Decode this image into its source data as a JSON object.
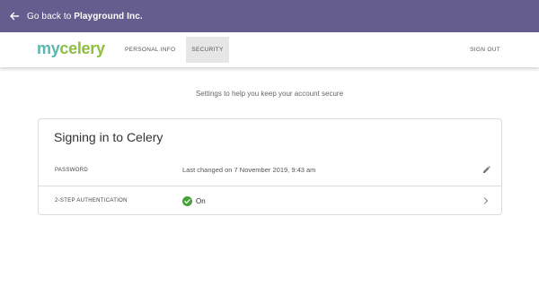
{
  "topbar": {
    "back_prefix": "Go back to ",
    "back_org": "Playground Inc."
  },
  "nav": {
    "logo_part1": "my",
    "logo_part2": "celery",
    "tabs": [
      {
        "label": "PERSONAL INFO",
        "active": false
      },
      {
        "label": "SECURITY",
        "active": true
      }
    ],
    "sign_out": "SIGN OUT"
  },
  "main": {
    "subtitle": "Settings to help you keep your account secure",
    "card": {
      "title": "Signing in to Celery",
      "rows": [
        {
          "label": "PASSWORD",
          "value": "Last changed on 7 November 2019, 9:43 am",
          "action_icon": "pencil-icon"
        },
        {
          "label": "2-STEP AUTHENTICATION",
          "value": "On",
          "status_icon": "check-circle-icon",
          "action_icon": "chevron-right-icon"
        }
      ]
    }
  },
  "colors": {
    "topbar": "#655d8e",
    "logo_my": "#5ab6b0",
    "logo_celery": "#8cbf3f",
    "status_on": "#47a23a"
  }
}
